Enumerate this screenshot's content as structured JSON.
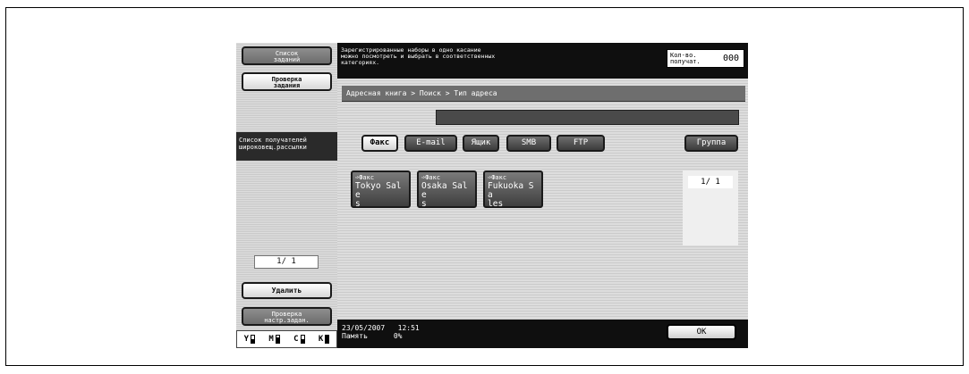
{
  "sidebar": {
    "job_list_button": "Список\nзаданий",
    "job_check_button": "Проверка\nзадания",
    "category_label": "Список получателей\nшироковещ.рассылки",
    "pager": "1/ 1",
    "delete_button": "Удалить",
    "check_settings_button": "Проверка\nнастр.задан.",
    "toner": [
      {
        "letter": "Y",
        "level": 0.55
      },
      {
        "letter": "M",
        "level": 0.7
      },
      {
        "letter": "C",
        "level": 0.45
      },
      {
        "letter": "K",
        "level": 0.95
      }
    ]
  },
  "header": {
    "message": "Зарегистрированные наборы в одно касание\nможно посмотреть и выбрать в соответственных\nкатегориях.",
    "recipients_label": "Кол-во.\nполучат.",
    "recipients_value": "000"
  },
  "breadcrumb": "Адресная книга > Поиск > Тип адреса",
  "type_tabs": {
    "fax": "Факс",
    "email": "E-mail",
    "box": "Ящик",
    "smb": "SMB",
    "ftp": "FTP",
    "group": "Группа"
  },
  "destinations": [
    {
      "type": "Факс",
      "name": "Tokyo Sale\ns"
    },
    {
      "type": "Факс",
      "name": "Osaka Sale\ns"
    },
    {
      "type": "Факс",
      "name": "Fukuoka Sa\nles"
    }
  ],
  "list_pager": "1/ 1",
  "footer": {
    "date": "23/05/2007",
    "time": "12:51",
    "memory_label": "Память",
    "memory_value": "0%",
    "ok_button": "OK"
  }
}
